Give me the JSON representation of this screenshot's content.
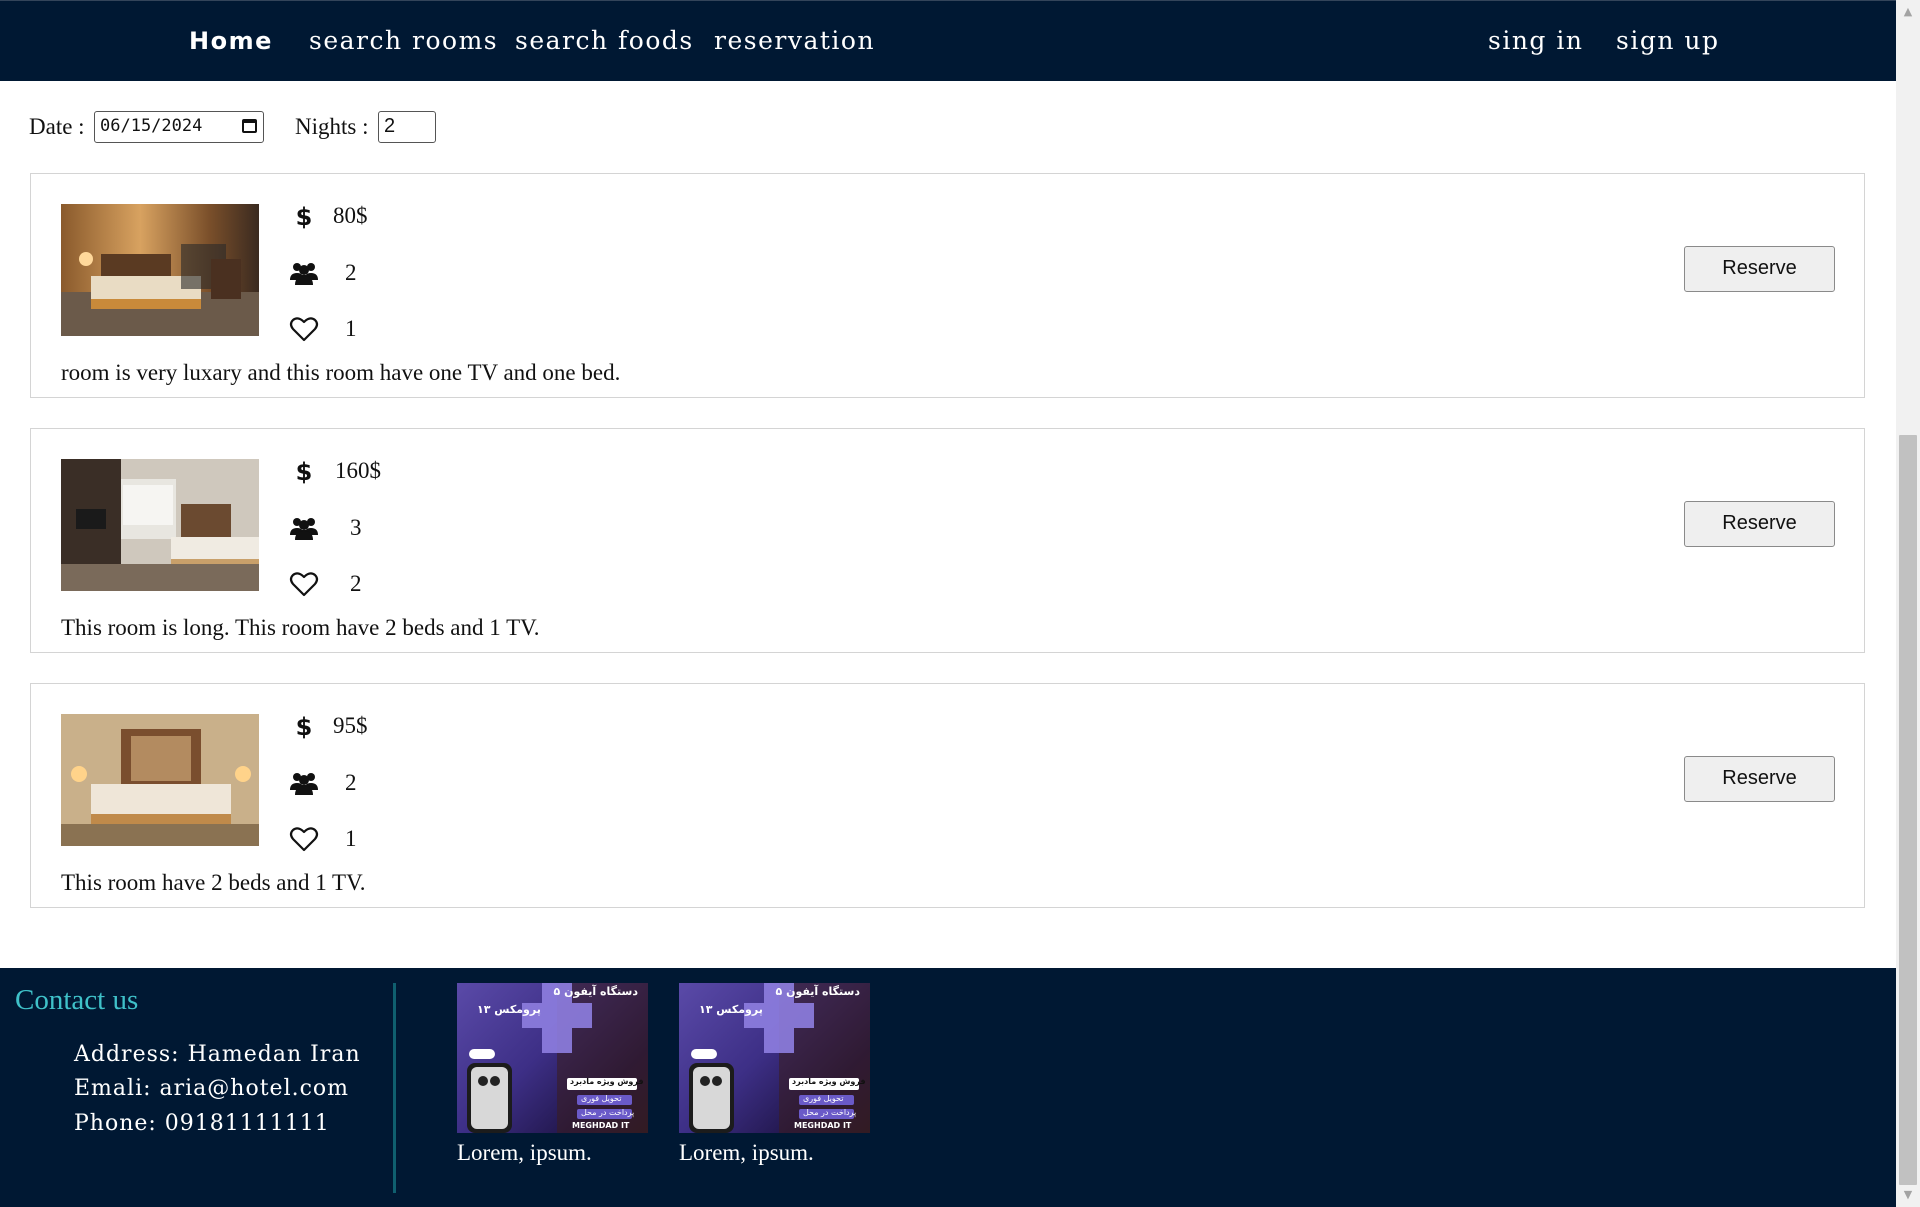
{
  "nav": {
    "home": "Home",
    "search_rooms": "search rooms",
    "search_foods": "search foods",
    "reservation": "reservation",
    "sign_in": "sing in",
    "sign_up": "sign up"
  },
  "filters": {
    "date_label": "Date :",
    "date_value": "06/15/2024",
    "nights_label": "Nights :",
    "nights_value": "2"
  },
  "rooms": [
    {
      "price": "80$",
      "capacity": "2",
      "likes": "1",
      "description": "room is very luxary and this room have one TV and one bed.",
      "button": "Reserve"
    },
    {
      "price": "160$",
      "capacity": "3",
      "likes": "2",
      "description": "This room is long. This room have 2 beds and 1 TV.",
      "button": "Reserve"
    },
    {
      "price": "95$",
      "capacity": "2",
      "likes": "1",
      "description": "This room have 2 beds and 1 TV.",
      "button": "Reserve"
    }
  ],
  "icons": {
    "price": "dollar-icon",
    "capacity": "users-icon",
    "likes": "heart-icon"
  },
  "footer": {
    "contact_title": "Contact us",
    "address": "Address: Hamedan Iran",
    "email": "Emali: aria@hotel.com",
    "phone": "Phone: 09181111111",
    "ads": [
      {
        "caption": "Lorem, ipsum.",
        "ad_text_1": "۵ دستگاه آیفون",
        "ad_text_2": "۱۳ پرومکس",
        "ad_text_3": "فروش ویژه مادبرد",
        "ad_text_4": "تحویل فوری",
        "ad_text_5": "پرداخت در محل",
        "ad_brand": "MEGHDAD IT"
      },
      {
        "caption": "Lorem, ipsum.",
        "ad_text_1": "۵ دستگاه آیفون",
        "ad_text_2": "۱۳ پرومکس",
        "ad_text_3": "فروش ویژه مادبرد",
        "ad_text_4": "تحویل فوری",
        "ad_text_5": "پرداخت در محل",
        "ad_brand": "MEGHDAD IT"
      }
    ]
  },
  "colors": {
    "navbar_bg": "#001833",
    "footer_bg": "#001833",
    "contact_title": "#3fc1c9",
    "card_border": "#d4d4d4"
  }
}
